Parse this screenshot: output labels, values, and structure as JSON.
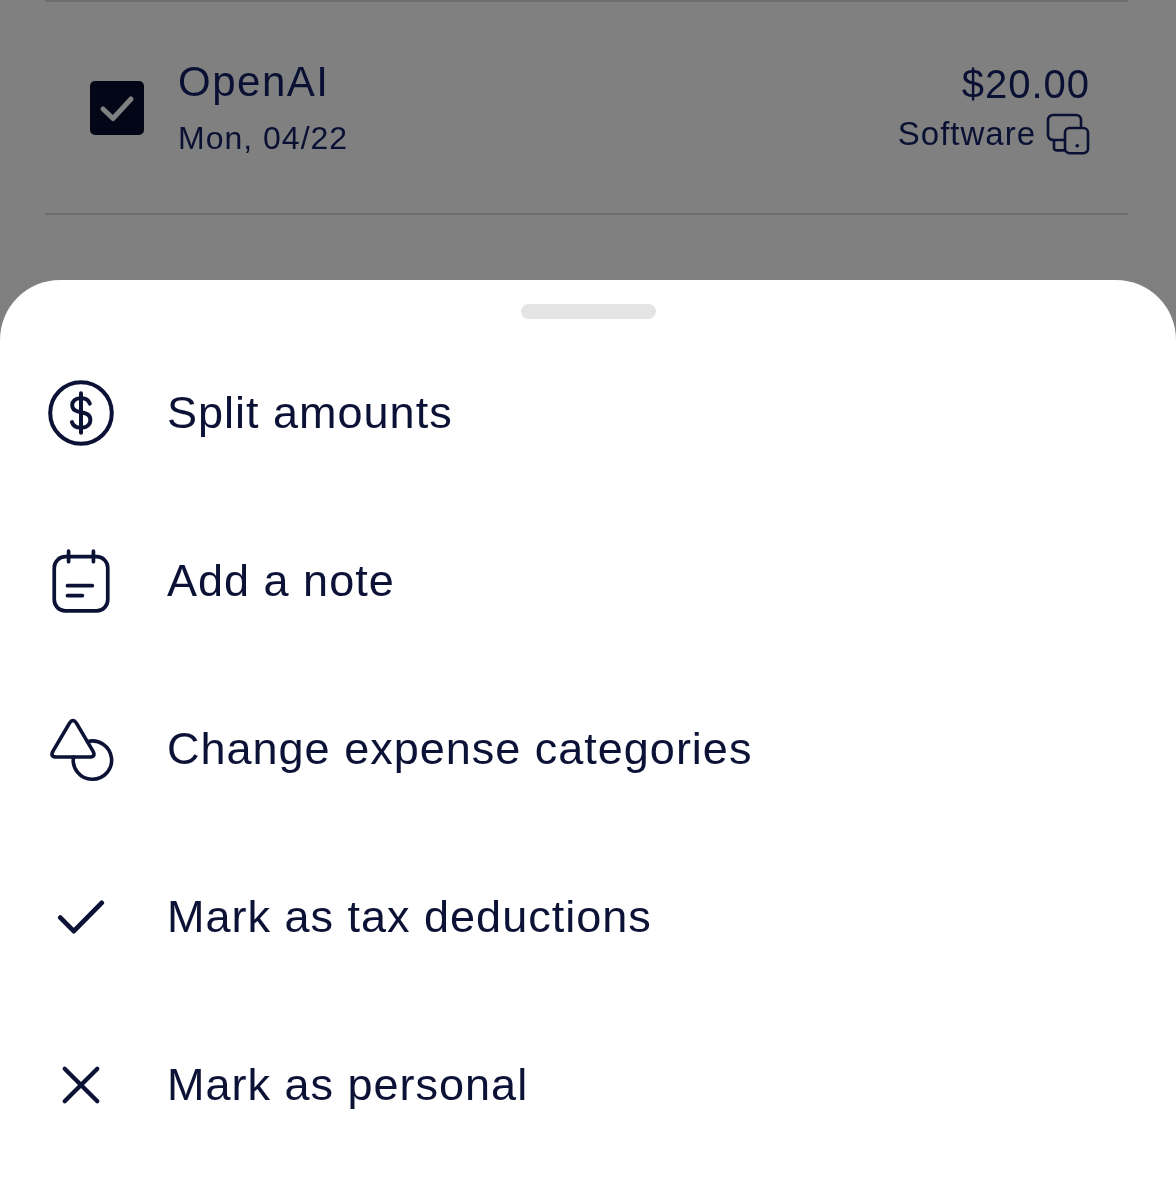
{
  "transaction": {
    "checked": true,
    "merchant": "OpenAI",
    "date": "Mon, 04/22",
    "amount": "$20.00",
    "category": "Software"
  },
  "action_sheet": {
    "actions": [
      {
        "kind": "split",
        "label": "Split amounts"
      },
      {
        "kind": "note",
        "label": "Add a note"
      },
      {
        "kind": "category",
        "label": "Change expense categories"
      },
      {
        "kind": "deduction",
        "label": "Mark as tax deductions"
      },
      {
        "kind": "personal",
        "label": "Mark as personal"
      }
    ]
  }
}
